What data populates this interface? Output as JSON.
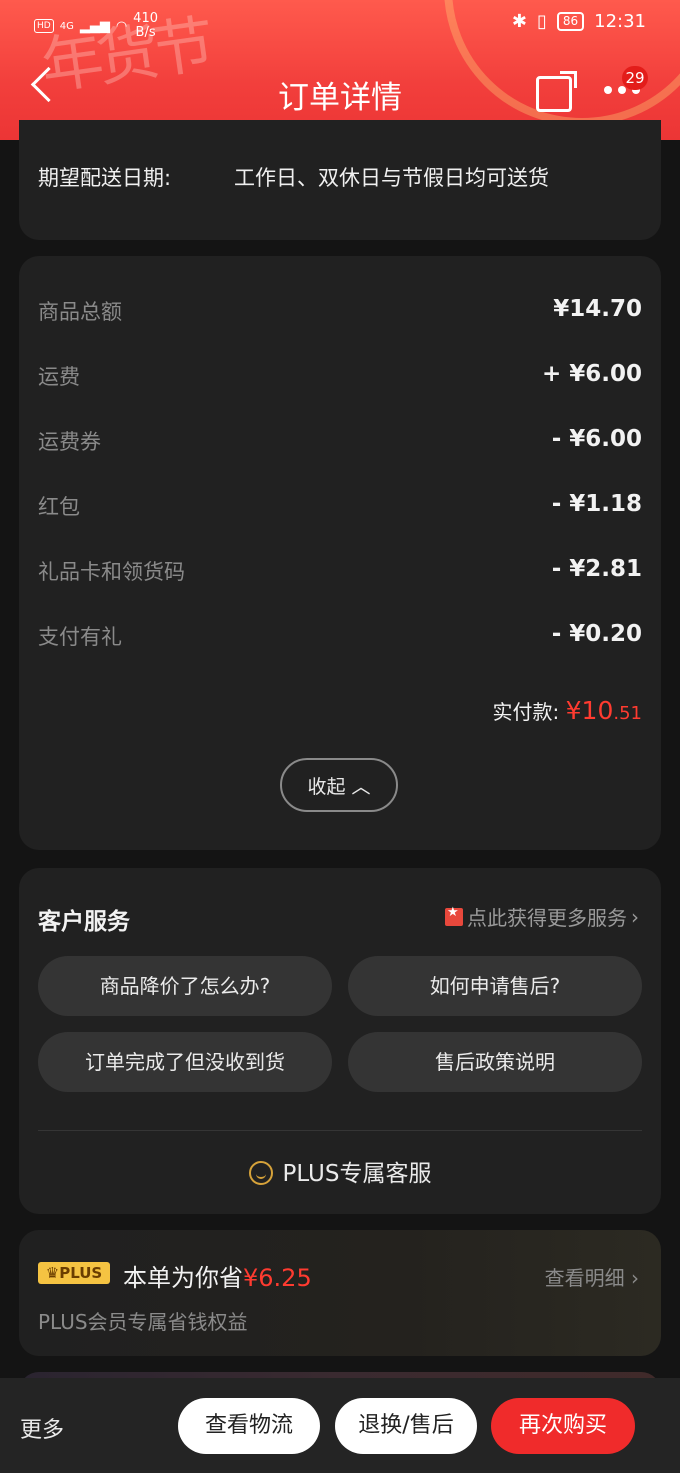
{
  "status_bar": {
    "left_label": "HD",
    "network": "4G",
    "speed_value": "410",
    "speed_unit": "B/s",
    "battery": "86",
    "time": "12:31"
  },
  "header": {
    "decoration": "年货节",
    "title": "订单详情",
    "badge_count": "29"
  },
  "delivery": {
    "label": "期望配送日期:",
    "value": "工作日、双休日与节假日均可送货"
  },
  "fees": [
    {
      "label": "商品总额",
      "value": "¥14.70"
    },
    {
      "label": "运费",
      "value": "+ ¥6.00"
    },
    {
      "label": "运费券",
      "value": "- ¥6.00"
    },
    {
      "label": "红包",
      "value": "- ¥1.18"
    },
    {
      "label": "礼品卡和领货码",
      "value": "- ¥2.81"
    },
    {
      "label": "支付有礼",
      "value": "- ¥0.20"
    }
  ],
  "paid": {
    "label": "实付款:",
    "currency": "¥",
    "amount_int": "10",
    "amount_dec": ".51"
  },
  "collapse_label": "收起",
  "service": {
    "title": "客户服务",
    "more_link": "点此获得更多服务",
    "questions": [
      "商品降价了怎么办?",
      "如何申请售后?",
      "订单完成了但没收到货",
      "售后政策说明"
    ],
    "plus_service": "PLUS专属客服"
  },
  "plus": {
    "badge": "PLUS",
    "title_prefix": "本单为你省",
    "saved": "¥6.25",
    "detail": "查看明细",
    "subtitle": "PLUS会员专属省钱权益"
  },
  "bottom_bar": {
    "more": "更多",
    "logistics": "查看物流",
    "return": "退换/售后",
    "rebuy": "再次购买"
  },
  "colors": {
    "header_red": "#f23f3c",
    "accent_red": "#ff3b30",
    "card_bg": "#212121",
    "plus_gold": "#f5c342"
  }
}
